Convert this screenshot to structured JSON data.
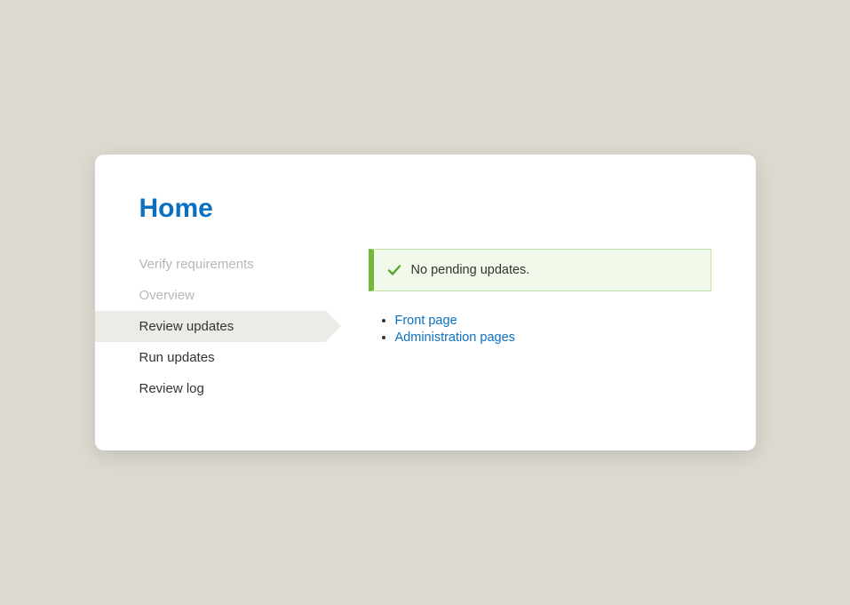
{
  "title": "Home",
  "steps": [
    {
      "label": "Verify requirements",
      "state": "disabled"
    },
    {
      "label": "Overview",
      "state": "disabled"
    },
    {
      "label": "Review updates",
      "state": "active"
    },
    {
      "label": "Run updates",
      "state": "normal"
    },
    {
      "label": "Review log",
      "state": "normal"
    }
  ],
  "status": {
    "message": "No pending updates.",
    "icon": "check-icon",
    "color_border": "#74b53b",
    "color_bg": "#f1faea"
  },
  "links": [
    {
      "label": "Front page"
    },
    {
      "label": "Administration pages"
    }
  ]
}
